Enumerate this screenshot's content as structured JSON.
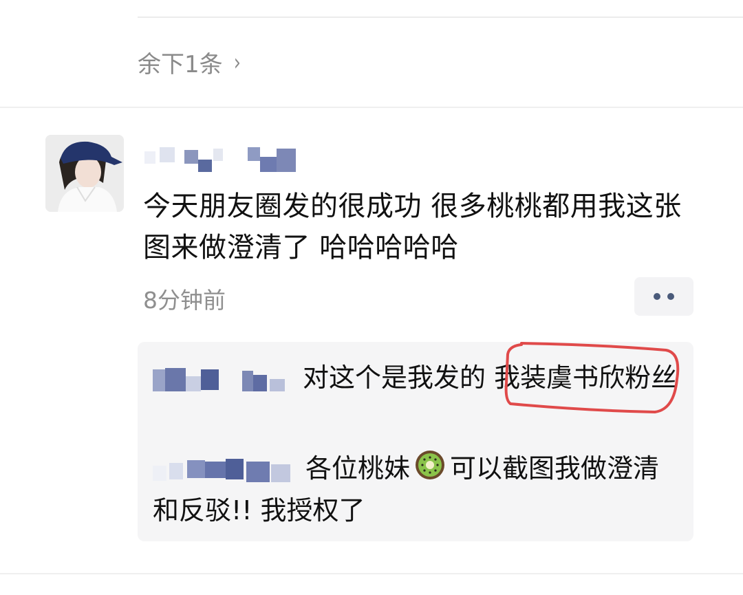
{
  "thread": {
    "more_replies_label": "余下1条",
    "more_replies_chevron": "›"
  },
  "post": {
    "avatar_icon": "user-avatar-photo",
    "text": "今天朋友圈发的很成功 很多桃桃都用我这张图来做澄清了 哈哈哈哈哈",
    "timestamp": "8分钟前",
    "more_icon": "ellipsis-icon"
  },
  "comments": [
    {
      "text": "对这个是我发的 我装虞书欣粉丝"
    },
    {
      "text_before_emoji": "各位桃妹",
      "emoji": "🥝",
      "text_after_emoji": "可以截图我做澄清和反驳!! 我授权了"
    }
  ],
  "colors": {
    "highlight_ring": "#e04a4a",
    "meta_text": "#8f8f8f",
    "panel_bg": "#f5f5f6"
  }
}
